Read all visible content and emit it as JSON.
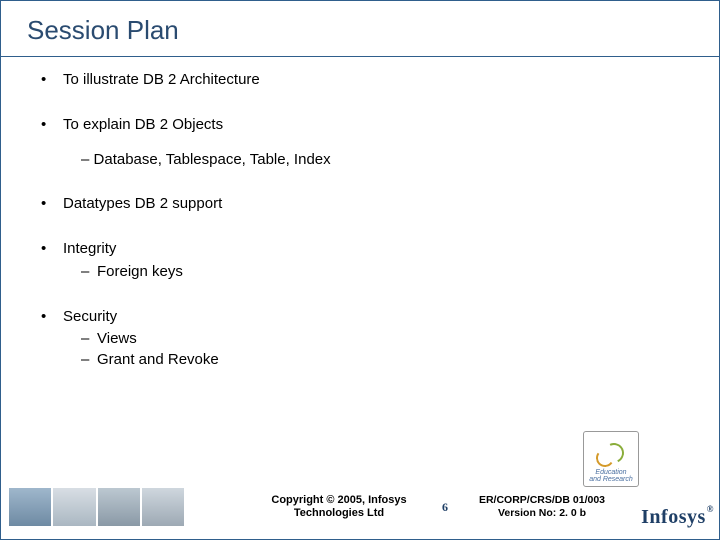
{
  "title": "Session Plan",
  "bullets": [
    {
      "text": "To illustrate DB 2 Architecture"
    },
    {
      "text": "To explain DB 2 Objects"
    },
    {
      "text": "Datatypes DB 2 support"
    },
    {
      "text": "Integrity"
    },
    {
      "text": "Security"
    }
  ],
  "sub_explain": "Database, Tablespace, Table, Index",
  "sub_integrity": [
    "Foreign keys"
  ],
  "sub_security": [
    "Views",
    "Grant and Revoke"
  ],
  "footer": {
    "copyright_l1": "Copyright © 2005, Infosys",
    "copyright_l2": "Technologies Ltd",
    "slide_number": "6",
    "docref_l1": "ER/CORP/CRS/DB 01/003",
    "docref_l2": "Version No: 2. 0 b",
    "edu_l1": "Education",
    "edu_l2": "and Research",
    "logo_text": "Infosys"
  }
}
